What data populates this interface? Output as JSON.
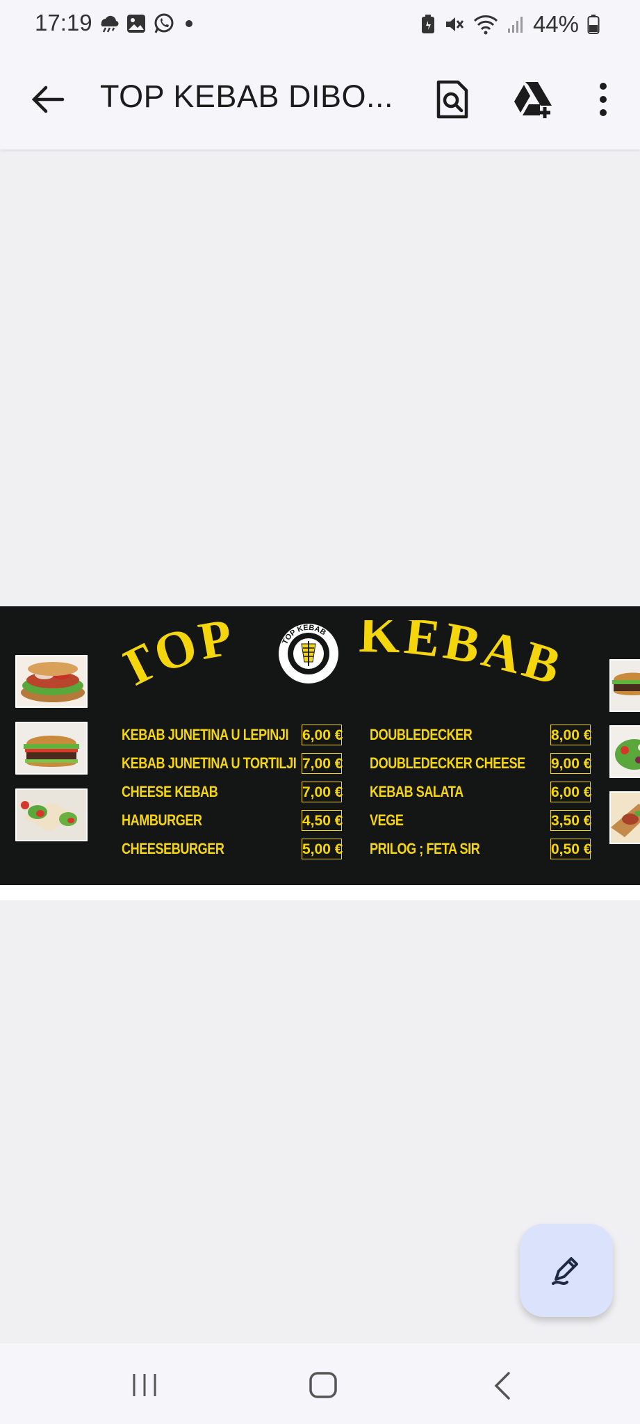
{
  "status_bar": {
    "time": "17:19",
    "battery": "44%"
  },
  "app_bar": {
    "title": "TOP KEBAB DIBO...",
    "icons": [
      "back-arrow-icon",
      "find-in-page-icon",
      "add-to-drive-icon",
      "more-vert-icon"
    ]
  },
  "menu": {
    "brand_top": "TOP",
    "brand_kebab": "KEBAB",
    "logo_text": "TOP KEBAB",
    "left_items": [
      {
        "name": "KEBAB JUNETINA U LEPINJI",
        "price": "6,00 €"
      },
      {
        "name": "KEBAB JUNETINA U TORTILJI",
        "price": "7,00 €"
      },
      {
        "name": "CHEESE KEBAB",
        "price": "7,00 €"
      },
      {
        "name": "HAMBURGER",
        "price": "4,50 €"
      },
      {
        "name": "CHEESEBURGER",
        "price": "5,00 €"
      }
    ],
    "right_items": [
      {
        "name": "DOUBLEDECKER",
        "price": "8,00 €"
      },
      {
        "name": "DOUBLEDECKER CHEESE",
        "price": "9,00 €"
      },
      {
        "name": "KEBAB SALATA",
        "price": "6,00 €"
      },
      {
        "name": "VEGE",
        "price": "3,50 €"
      },
      {
        "name": "PRILOG ; FETA SIR",
        "price": "0,50 €"
      }
    ],
    "colors": {
      "accent": "#f5d60c",
      "background": "#141515"
    }
  },
  "fab": {
    "icon": "edit-pen-icon"
  },
  "nav_bar": {
    "icons": [
      "recents-icon",
      "home-icon",
      "back-icon"
    ]
  }
}
